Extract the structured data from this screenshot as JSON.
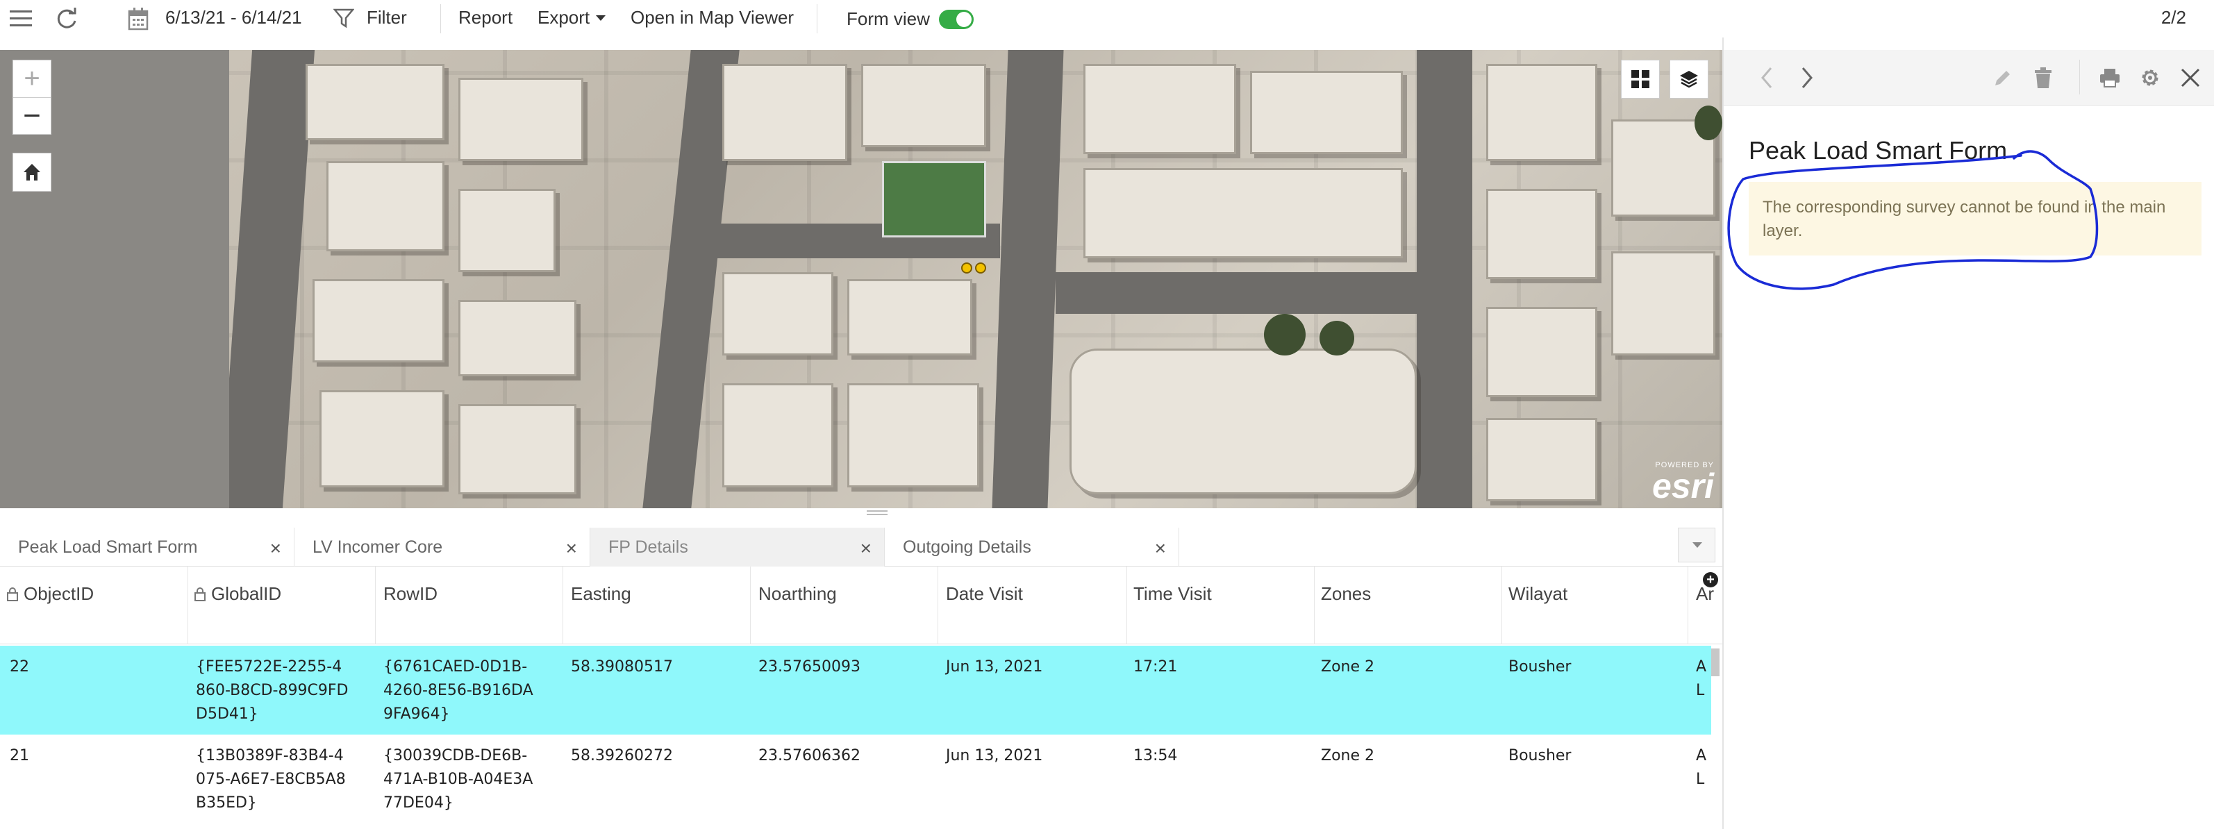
{
  "toolbar": {
    "date_range": "6/13/21 - 6/14/21",
    "filter_label": "Filter",
    "report_label": "Report",
    "export_label": "Export",
    "map_viewer_label": "Open in Map Viewer",
    "form_view_label": "Form view",
    "form_view_on": true,
    "page_count": "2/2"
  },
  "map": {
    "attribution_small": "POWERED BY",
    "attribution_logo": "esri",
    "zoom_in": "+",
    "zoom_out": "−"
  },
  "tabs": [
    {
      "label": "Peak Load Smart Form",
      "active": false
    },
    {
      "label": "LV Incomer Core",
      "active": false
    },
    {
      "label": "FP Details",
      "active": true
    },
    {
      "label": "Outgoing Details",
      "active": false
    }
  ],
  "table": {
    "columns": [
      "ObjectID",
      "GlobalID",
      "RowID",
      "Easting",
      "Noarthing",
      "Date Visit",
      "Time Visit",
      "Zones",
      "Wilayat",
      "Ar"
    ],
    "locked_columns": [
      "ObjectID",
      "GlobalID"
    ],
    "rows": [
      {
        "selected": true,
        "cells": [
          "22",
          "{FEE5722E-2255-4860-B8CD-899C9FDD5D41}",
          "{6761CAED-0D1B-4260-8E56-B916DA9FA964}",
          "58.39080517",
          "23.57650093",
          "Jun 13, 2021",
          "17:21",
          "Zone 2",
          "Bousher",
          "AL"
        ]
      },
      {
        "selected": false,
        "cells": [
          "21",
          "{13B0389F-83B4-4075-A6E7-E8CB5A8B35ED}",
          "{30039CDB-DE6B-471A-B10B-A04E3A77DE04}",
          "58.39260272",
          "23.57606362",
          "Jun 13, 2021",
          "13:54",
          "Zone 2",
          "Bousher",
          "AL"
        ]
      }
    ]
  },
  "panel": {
    "form_title": "Peak Load Smart Form",
    "warning_message": "The corresponding survey cannot be found in the main layer.",
    "annotation_color": "#1a2bd6"
  },
  "colors": {
    "selected_row": "#8ff8fb",
    "toggle_on": "#35ac46",
    "warning_bg": "#fdf7e3"
  }
}
